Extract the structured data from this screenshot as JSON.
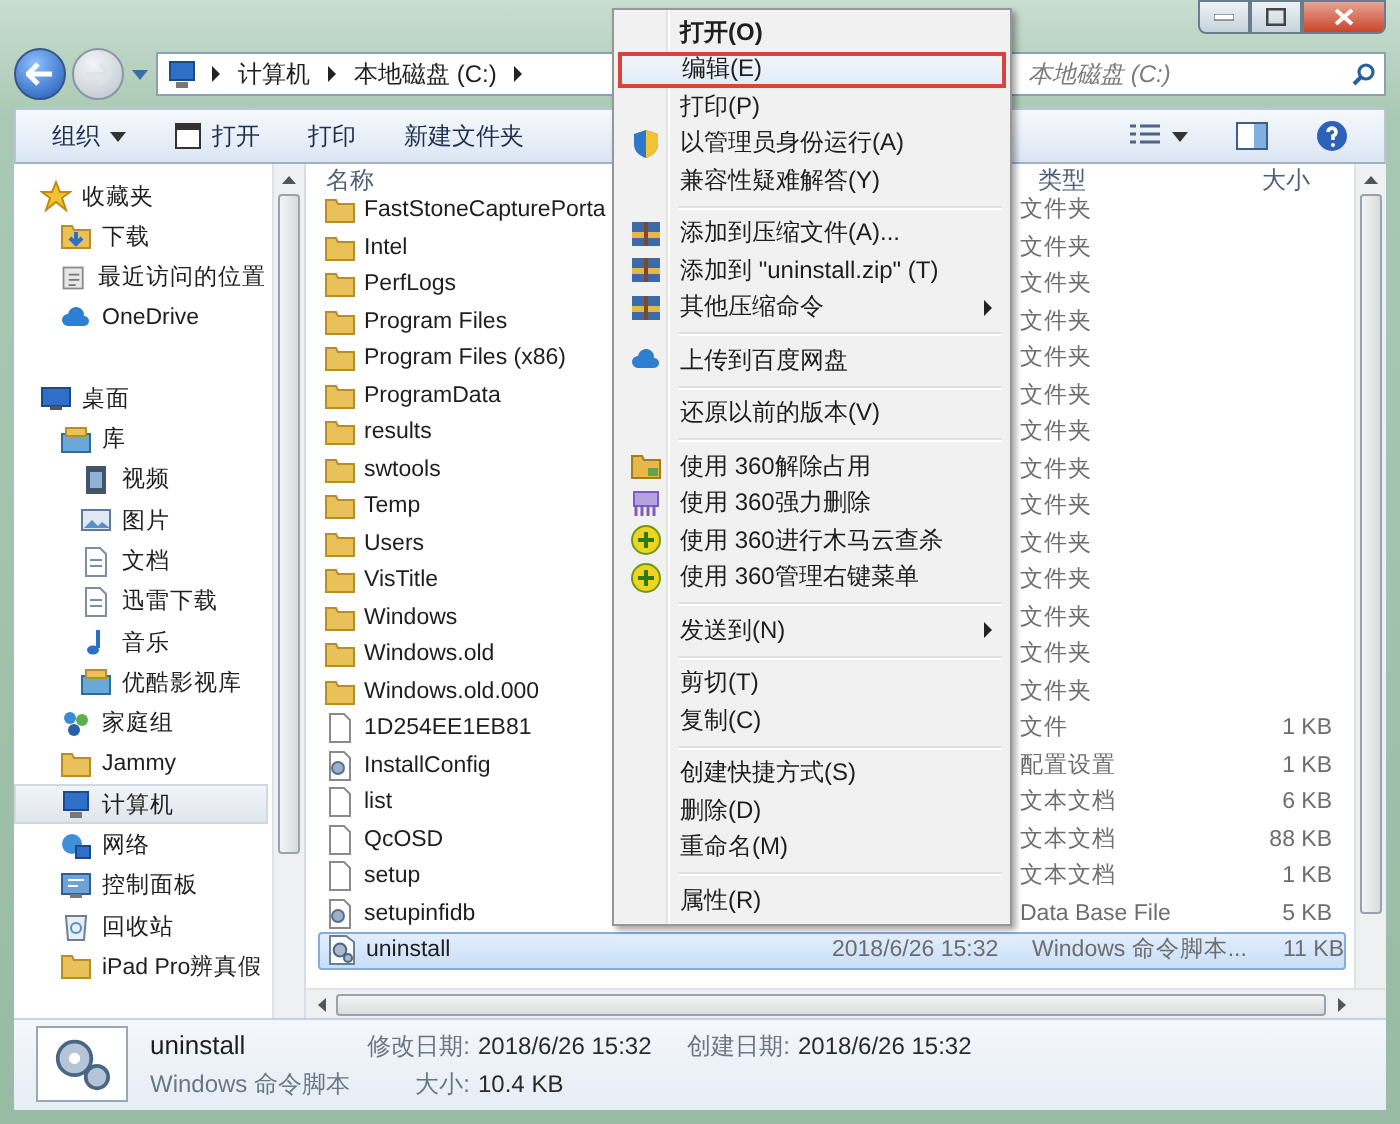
{
  "address_bar": {
    "path": [
      "计算机",
      "本地磁盘 (C:)"
    ]
  },
  "search": {
    "placeholder": "本地磁盘 (C:)"
  },
  "toolbar": {
    "items": [
      {
        "label": "组织",
        "kind": "dropdown"
      },
      {
        "label": "打开",
        "kind": "icon"
      },
      {
        "label": "打印",
        "kind": "plain"
      },
      {
        "label": "新建文件夹",
        "kind": "plain"
      }
    ]
  },
  "sidebar": {
    "items": [
      {
        "label": "收藏夹",
        "selected": false,
        "children": [
          {
            "label": "下载",
            "selected": false
          },
          {
            "label": "最近访问的位置",
            "selected": false
          },
          {
            "label": "OneDrive",
            "selected": false
          }
        ]
      },
      {
        "label": "桌面",
        "selected": false,
        "children": [
          {
            "label": "库",
            "selected": false,
            "children": [
              {
                "label": "视频",
                "selected": false
              },
              {
                "label": "图片",
                "selected": false
              },
              {
                "label": "文档",
                "selected": false
              },
              {
                "label": "迅雷下载",
                "selected": false
              },
              {
                "label": "音乐",
                "selected": false
              },
              {
                "label": "优酷影视库",
                "selected": false
              }
            ]
          },
          {
            "label": "家庭组",
            "selected": false
          },
          {
            "label": "Jammy",
            "selected": false
          },
          {
            "label": "计算机",
            "selected": true
          },
          {
            "label": "网络",
            "selected": false
          },
          {
            "label": "控制面板",
            "selected": false
          },
          {
            "label": "回收站",
            "selected": false
          },
          {
            "label": "iPad Pro辨真假",
            "selected": false
          }
        ]
      }
    ]
  },
  "file_list": {
    "columns": [
      {
        "label": "名称",
        "kind": "name"
      },
      {
        "label": "类型",
        "kind": "type"
      },
      {
        "label": "大小",
        "kind": "size"
      }
    ],
    "rows": [
      {
        "name": "FastStoneCapturePorta",
        "kind": "folder",
        "type": "文件夹",
        "selected": false
      },
      {
        "name": "Intel",
        "kind": "folder",
        "type": "文件夹",
        "selected": false
      },
      {
        "name": "PerfLogs",
        "kind": "folder",
        "type": "文件夹",
        "selected": false
      },
      {
        "name": "Program Files",
        "kind": "folder",
        "type": "文件夹",
        "selected": false
      },
      {
        "name": "Program Files (x86)",
        "kind": "folder",
        "type": "文件夹",
        "selected": false
      },
      {
        "name": "ProgramData",
        "kind": "folder",
        "type": "文件夹",
        "selected": false
      },
      {
        "name": "results",
        "kind": "folder",
        "type": "文件夹",
        "selected": false
      },
      {
        "name": "swtools",
        "kind": "folder",
        "type": "文件夹",
        "selected": false
      },
      {
        "name": "Temp",
        "kind": "folder",
        "type": "文件夹",
        "selected": false
      },
      {
        "name": "Users",
        "kind": "folder",
        "type": "文件夹",
        "selected": false
      },
      {
        "name": "VisTitle",
        "kind": "folder",
        "type": "文件夹",
        "selected": false
      },
      {
        "name": "Windows",
        "kind": "folder",
        "type": "文件夹",
        "selected": false
      },
      {
        "name": "Windows.old",
        "kind": "folder",
        "type": "文件夹",
        "selected": false
      },
      {
        "name": "Windows.old.000",
        "kind": "folder",
        "type": "文件夹",
        "selected": false
      },
      {
        "name": "1D254EE1EB81",
        "kind": "file",
        "type": "文件",
        "size": "1 KB",
        "selected": false
      },
      {
        "name": "InstallConfig",
        "kind": "config",
        "type": "配置设置",
        "size": "1 KB",
        "selected": false
      },
      {
        "name": "list",
        "kind": "file",
        "type": "文本文档",
        "size": "6 KB",
        "selected": false
      },
      {
        "name": "QcOSD",
        "kind": "file",
        "type": "文本文档",
        "size": "88 KB",
        "selected": false
      },
      {
        "name": "setup",
        "kind": "file",
        "type": "文本文档",
        "size": "1 KB",
        "selected": false
      },
      {
        "name": "setupinfidb",
        "kind": "config",
        "type": "Data Base File",
        "size": "5 KB",
        "selected": false
      },
      {
        "name": "uninstall",
        "kind": "script",
        "date": "2018/6/26 15:32",
        "type": "Windows 命令脚本...",
        "size": "11 KB",
        "selected": true
      }
    ]
  },
  "context_menu": {
    "items": [
      {
        "kind": "item",
        "label": "打开(O)",
        "default": true,
        "selected": false
      },
      {
        "kind": "item",
        "label": "编辑(E)",
        "default": false,
        "selected": true
      },
      {
        "kind": "item",
        "label": "打印(P)",
        "default": false,
        "selected": false
      },
      {
        "kind": "item",
        "label": "以管理员身份运行(A)",
        "default": false,
        "selected": false
      },
      {
        "kind": "item",
        "label": "兼容性疑难解答(Y)",
        "default": false,
        "selected": false
      },
      {
        "kind": "separator"
      },
      {
        "kind": "item",
        "label": "添加到压缩文件(A)...",
        "default": false,
        "selected": false
      },
      {
        "kind": "item",
        "label": "添加到 \"uninstall.zip\" (T)",
        "default": false,
        "selected": false
      },
      {
        "kind": "item",
        "label": "其他压缩命令",
        "submenu": true,
        "default": false,
        "selected": false
      },
      {
        "kind": "separator"
      },
      {
        "kind": "item",
        "label": "上传到百度网盘",
        "default": false,
        "selected": false
      },
      {
        "kind": "separator"
      },
      {
        "kind": "item",
        "label": "还原以前的版本(V)",
        "default": false,
        "selected": false
      },
      {
        "kind": "separator"
      },
      {
        "kind": "item",
        "label": "使用 360解除占用",
        "default": false,
        "selected": false
      },
      {
        "kind": "item",
        "label": "使用 360强力删除",
        "default": false,
        "selected": false
      },
      {
        "kind": "item",
        "label": "使用 360进行木马云查杀",
        "default": false,
        "selected": false
      },
      {
        "kind": "item",
        "label": "使用 360管理右键菜单",
        "default": false,
        "selected": false
      },
      {
        "kind": "separator"
      },
      {
        "kind": "item",
        "label": "发送到(N)",
        "submenu": true,
        "default": false,
        "selected": false
      },
      {
        "kind": "separator"
      },
      {
        "kind": "item",
        "label": "剪切(T)",
        "default": false,
        "selected": false
      },
      {
        "kind": "item",
        "label": "复制(C)",
        "default": false,
        "selected": false
      },
      {
        "kind": "separator"
      },
      {
        "kind": "item",
        "label": "创建快捷方式(S)",
        "default": false,
        "selected": false
      },
      {
        "kind": "item",
        "label": "删除(D)",
        "default": false,
        "selected": false
      },
      {
        "kind": "item",
        "label": "重命名(M)",
        "default": false,
        "selected": false
      },
      {
        "kind": "separator"
      },
      {
        "kind": "item",
        "label": "属性(R)",
        "default": false,
        "selected": false
      }
    ]
  },
  "details": {
    "name": "uninstall",
    "type": "Windows 命令脚本",
    "fields": [
      {
        "label": "修改日期:",
        "value": "2018/6/26 15:32"
      },
      {
        "label": "大小:",
        "value": "10.4 KB"
      },
      {
        "label": "创建日期:",
        "value": "2018/6/26 15:32"
      }
    ]
  }
}
